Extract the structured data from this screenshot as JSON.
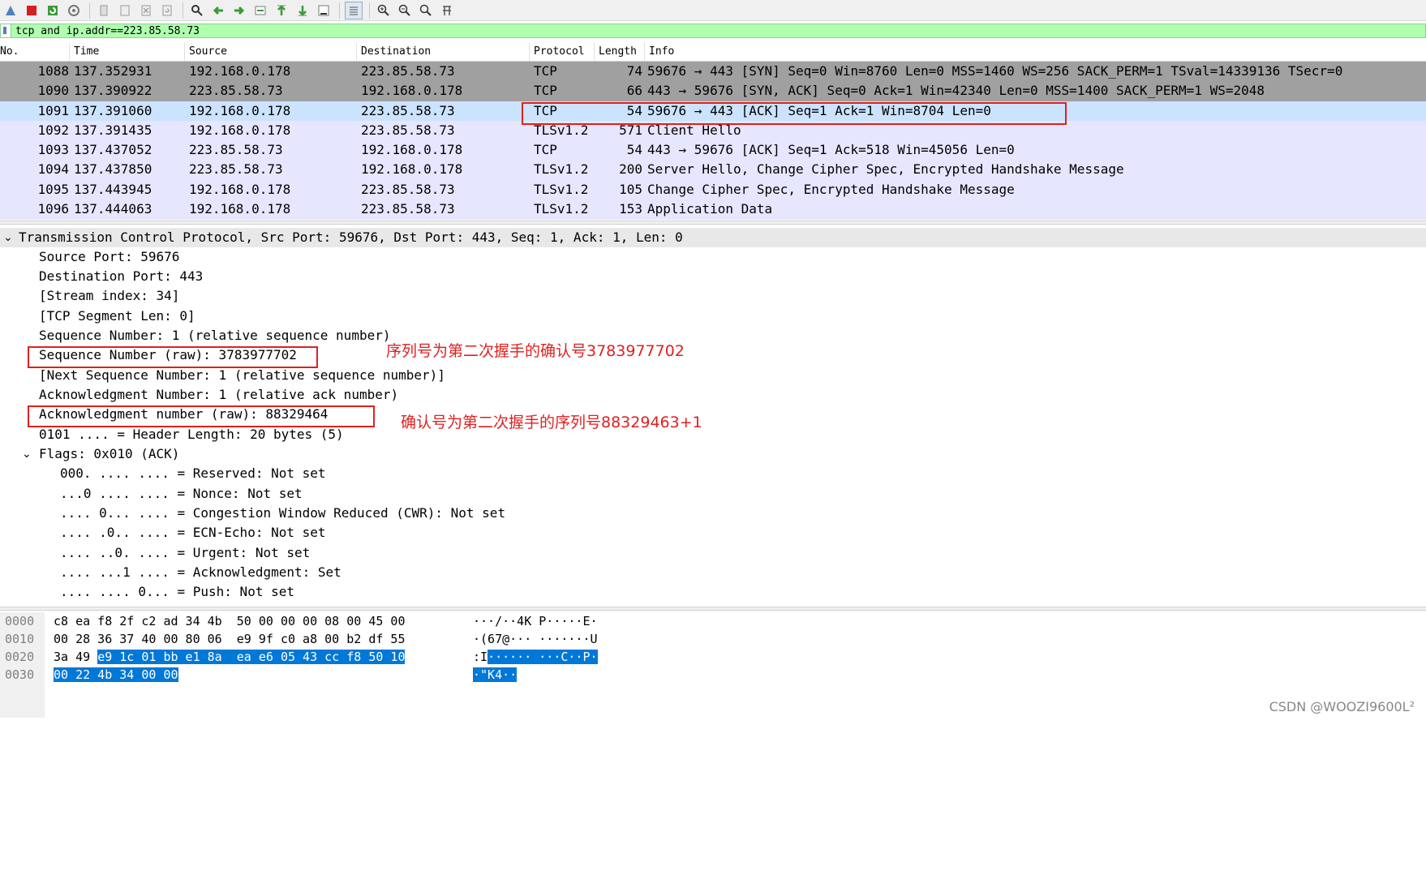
{
  "toolbar": {
    "icons": [
      "shark-fin-icon",
      "stop-icon",
      "restart-icon",
      "options-gear-icon",
      "open-file-icon",
      "save-file-icon",
      "close-file-icon",
      "reload-icon",
      "find-icon",
      "go-back-icon",
      "go-forward-icon",
      "go-to-packet-icon",
      "go-first-icon",
      "go-last-icon",
      "autoscroll-icon",
      "colorize-icon",
      "zoom-in-icon",
      "zoom-out-icon",
      "zoom-normal-icon",
      "resize-columns-icon"
    ]
  },
  "filter": {
    "value": "tcp and ip.addr==223.85.58.73"
  },
  "packet_list": {
    "columns": [
      "No.",
      "Time",
      "Source",
      "Destination",
      "Protocol",
      "Length",
      "Info"
    ],
    "rows": [
      {
        "no": "1088",
        "time": "137.352931",
        "src": "192.168.0.178",
        "dst": "223.85.58.73",
        "proto": "TCP",
        "len": "74",
        "info": "59676 → 443 [SYN] Seq=0 Win=8760 Len=0 MSS=1460 WS=256 SACK_PERM=1 TSval=14339136 TSecr=0"
      },
      {
        "no": "1090",
        "time": "137.390922",
        "src": "223.85.58.73",
        "dst": "192.168.0.178",
        "proto": "TCP",
        "len": "66",
        "info": "443 → 59676 [SYN, ACK] Seq=0 Ack=1 Win=42340 Len=0 MSS=1400 SACK_PERM=1 WS=2048"
      },
      {
        "no": "1091",
        "time": "137.391060",
        "src": "192.168.0.178",
        "dst": "223.85.58.73",
        "proto": "TCP",
        "len": "54",
        "info": "59676 → 443 [ACK] Seq=1 Ack=1 Win=8704 Len=0"
      },
      {
        "no": "1092",
        "time": "137.391435",
        "src": "192.168.0.178",
        "dst": "223.85.58.73",
        "proto": "TLSv1.2",
        "len": "571",
        "info": "Client Hello"
      },
      {
        "no": "1093",
        "time": "137.437052",
        "src": "223.85.58.73",
        "dst": "192.168.0.178",
        "proto": "TCP",
        "len": "54",
        "info": "443 → 59676 [ACK] Seq=1 Ack=518 Win=45056 Len=0"
      },
      {
        "no": "1094",
        "time": "137.437850",
        "src": "223.85.58.73",
        "dst": "192.168.0.178",
        "proto": "TLSv1.2",
        "len": "200",
        "info": "Server Hello, Change Cipher Spec, Encrypted Handshake Message"
      },
      {
        "no": "1095",
        "time": "137.443945",
        "src": "192.168.0.178",
        "dst": "223.85.58.73",
        "proto": "TLSv1.2",
        "len": "105",
        "info": "Change Cipher Spec, Encrypted Handshake Message"
      },
      {
        "no": "1096",
        "time": "137.444063",
        "src": "192.168.0.178",
        "dst": "223.85.58.73",
        "proto": "TLSv1.2",
        "len": "153",
        "info": "Application Data"
      }
    ]
  },
  "details": {
    "header": "Transmission Control Protocol, Src Port: 59676, Dst Port: 443, Seq: 1, Ack: 1, Len: 0",
    "lines": [
      "Source Port: 59676",
      "Destination Port: 443",
      "[Stream index: 34]",
      "[TCP Segment Len: 0]",
      "Sequence Number: 1    (relative sequence number)",
      "Sequence Number (raw): 3783977702",
      "[Next Sequence Number: 1    (relative sequence number)]",
      "Acknowledgment Number: 1    (relative ack number)",
      "Acknowledgment number (raw): 88329464",
      "0101 .... = Header Length: 20 bytes (5)",
      "Flags: 0x010 (ACK)"
    ],
    "flags": [
      "000. .... .... = Reserved: Not set",
      "...0 .... .... = Nonce: Not set",
      ".... 0... .... = Congestion Window Reduced (CWR): Not set",
      ".... .0.. .... = ECN-Echo: Not set",
      ".... ..0. .... = Urgent: Not set",
      ".... ...1 .... = Acknowledgment: Set",
      ".... .... 0... = Push: Not set"
    ]
  },
  "annotations": {
    "seq_note": "序列号为第二次握手的确认号3783977702",
    "ack_note": "确认号为第二次握手的序列号88329463+1"
  },
  "hex": {
    "offsets": [
      "0000",
      "0010",
      "0020",
      "0030"
    ],
    "line0": {
      "hex": "c8 ea f8 2f c2 ad 34 4b  50 00 00 00 08 00 45 00",
      "ascii": "···/··4K P·····E·"
    },
    "line1": {
      "hex": "00 28 36 37 40 00 80 06  e9 9f c0 a8 00 b2 df 55",
      "ascii": "·(67@··· ·······U"
    },
    "line2": {
      "hex_plain": "3a 49 ",
      "hex_hl": "e9 1c 01 bb e1 8a  ea e6 05 43 cc f8 50 10",
      "ascii_plain": ":I",
      "ascii_hl": "······ ···C··P·"
    },
    "line3": {
      "hex_hl": "00 22 4b 34 00 00",
      "ascii_hl": "·\"K4··"
    }
  },
  "watermark": "CSDN @WOOZI9600L²"
}
